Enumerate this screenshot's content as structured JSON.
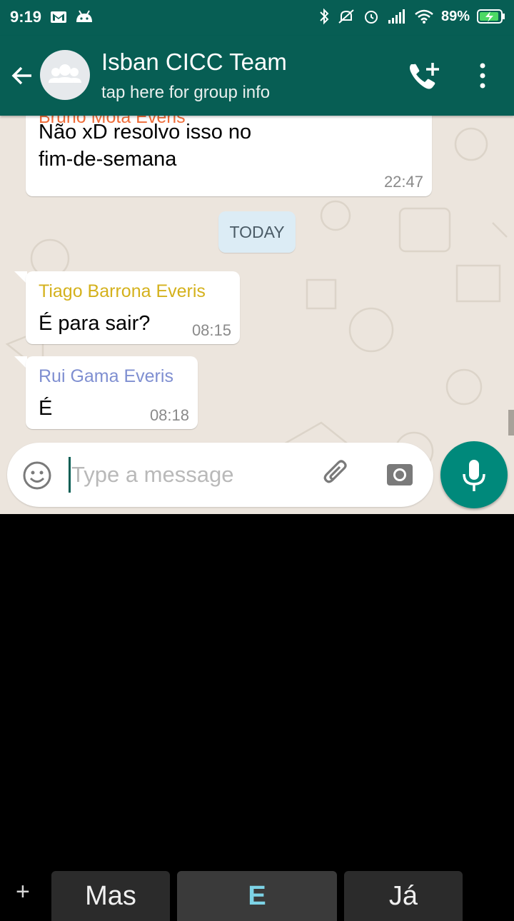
{
  "status_bar": {
    "time": "9:19",
    "battery": "89%"
  },
  "header": {
    "title": "Isban CICC Team",
    "subtitle": "tap here for group info"
  },
  "messages": [
    {
      "sender": "Bruno Mota Everis",
      "sender_color": "#ef6c38",
      "text_line1": "Não xD resolvo isso no",
      "text_line2": "fim-de-semana",
      "time": "22:47"
    },
    {
      "sender": "Tiago Barrona Everis",
      "sender_color": "#d4b11c",
      "text": "É para sair?",
      "time": "08:15"
    },
    {
      "sender": "Rui Gama Everis",
      "sender_color": "#7f8fd1",
      "text": "É",
      "time": "08:18"
    }
  ],
  "date_divider": "TODAY",
  "composer": {
    "placeholder": "Type a message"
  },
  "keyboard": {
    "suggestions": [
      "Mas",
      "E",
      "Já"
    ],
    "plus": "+"
  },
  "colors": {
    "header": "#075e54",
    "chat_bg": "#ece5dd",
    "mic_button": "#00897b",
    "highlight_suggestion": "#7dd3e6"
  }
}
